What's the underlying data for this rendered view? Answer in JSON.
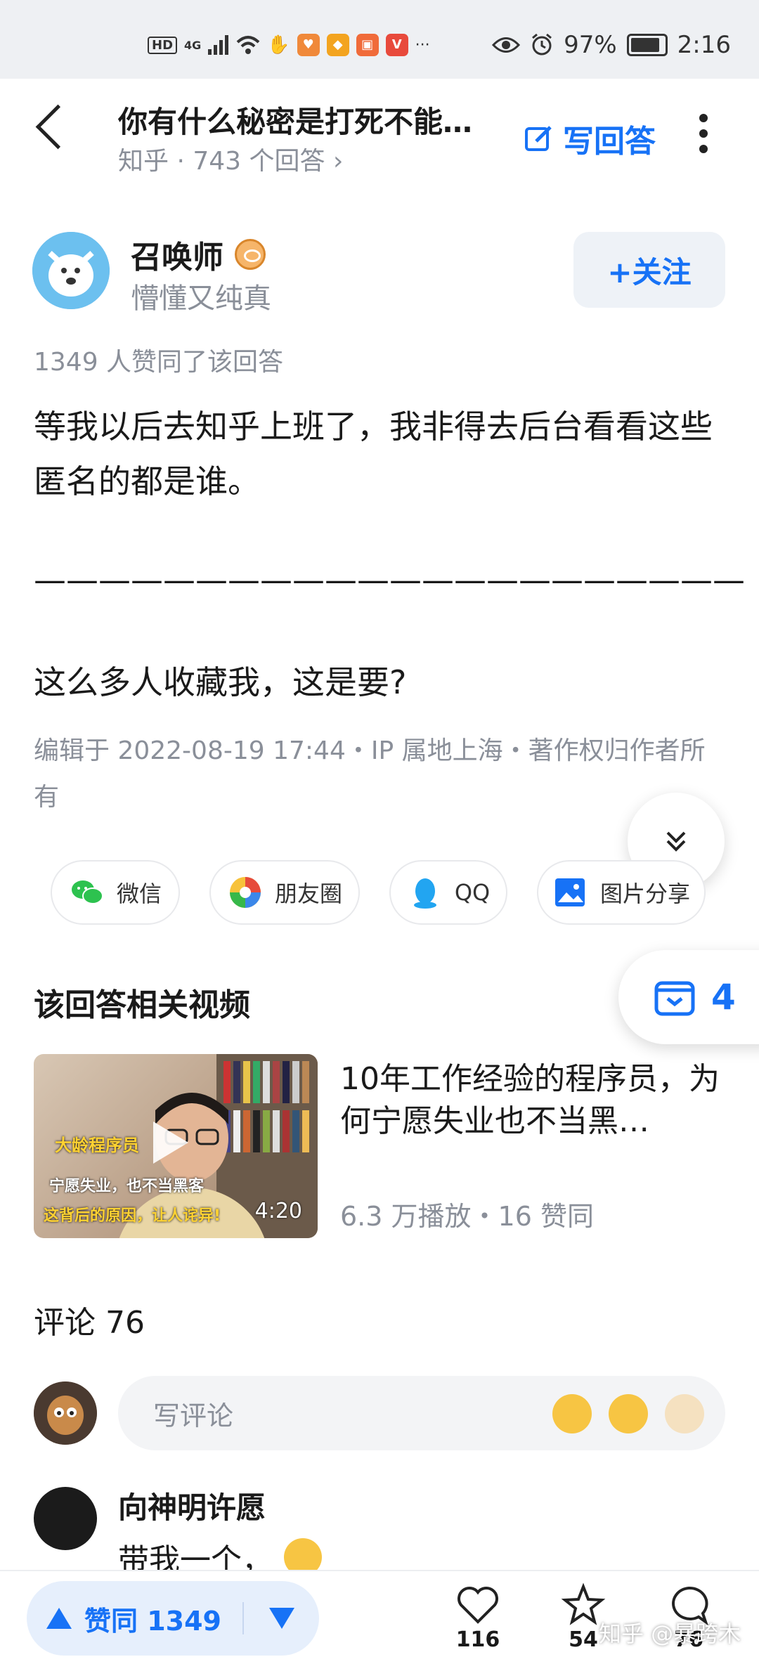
{
  "status_bar": {
    "left_icons": [
      "HD",
      "4G"
    ],
    "app_chips": [
      "app-notif-1",
      "app-notif-2",
      "app-notif-3",
      "app-notif-4",
      "app-notif-5"
    ],
    "ellipsis": "···",
    "battery": "97%",
    "time": "2:16"
  },
  "header": {
    "title": "你有什么秘密是打死不能…",
    "source": "知乎",
    "answers": "743 个回答",
    "write_label": "写回答"
  },
  "author": {
    "name": "召唤师",
    "bio": "懵懂又纯真",
    "follow_label": "+关注"
  },
  "answer": {
    "agree_line": "1349 人赞同了该回答",
    "paragraphs": [
      "等我以后去知乎上班了，我非得去后台看看这些匿名的都是谁。",
      "——————————————————————",
      "这么多人收藏我，这是要?"
    ],
    "meta": "编辑于 2022-08-19 17:44・IP 属地上海・著作权归作者所有"
  },
  "share": [
    {
      "label": "微信",
      "icon": "wechat-icon"
    },
    {
      "label": "朋友圈",
      "icon": "moments-icon"
    },
    {
      "label": "QQ",
      "icon": "qq-icon"
    },
    {
      "label": "图片分享",
      "icon": "image-share-icon"
    }
  ],
  "favorites_count": "4",
  "related": {
    "section_title": "该回答相关视频",
    "video": {
      "title": "10年工作经验的程序员，为何宁愿失业也不当黑…",
      "meta": "6.3 万播放・16 赞同",
      "duration": "4:20",
      "thumb_caption_1": "大龄程序员",
      "thumb_caption_2": "宁愿失业，也不当黑客",
      "thumb_caption_3": "这背后的原因，让人诧异!"
    }
  },
  "comments": {
    "header": "评论 76",
    "input_placeholder": "写评论",
    "first": {
      "name": "向神明许愿",
      "text": "带我一个，"
    }
  },
  "bottom_bar": {
    "vote_label": "赞同 1349",
    "likes": "116",
    "favorites": "54",
    "comments": "76",
    "watermark": "知乎 @暴跨木"
  },
  "colors": {
    "accent": "#1772f6",
    "muted": "#8a8f99"
  }
}
